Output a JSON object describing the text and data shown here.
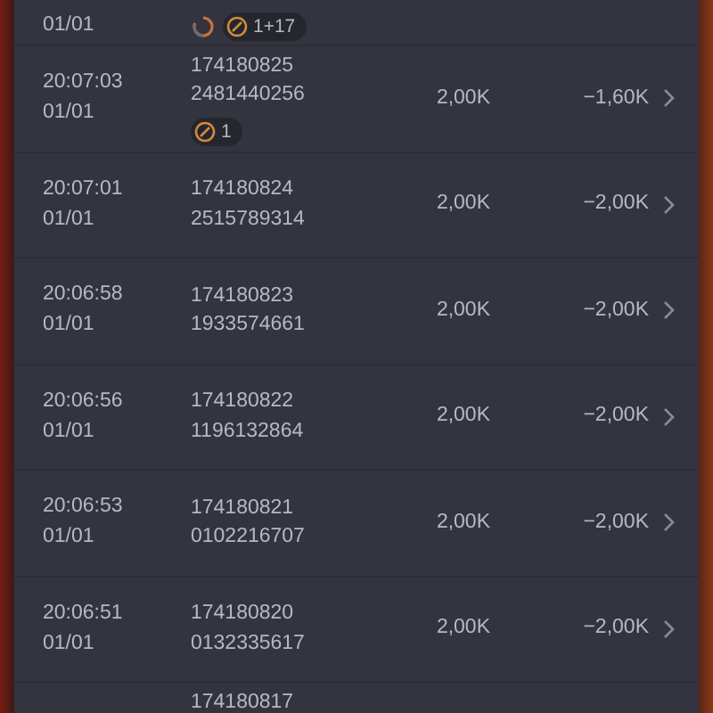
{
  "rows": [
    {
      "kind": "topcut",
      "date": "01/01",
      "badges": [
        {
          "kind": "refresh"
        },
        {
          "kind": "count",
          "text": "1+17"
        }
      ]
    },
    {
      "kind": "full",
      "time": "20:07:03",
      "date": "01/01",
      "ids": [
        "174180825",
        "2481440256"
      ],
      "badges": [
        {
          "kind": "count",
          "text": "1"
        }
      ],
      "amount": "2,00K",
      "pnl": "−1,60K"
    },
    {
      "kind": "full",
      "time": "20:07:01",
      "date": "01/01",
      "ids": [
        "174180824",
        "2515789314"
      ],
      "amount": "2,00K",
      "pnl": "−2,00K"
    },
    {
      "kind": "full",
      "time": "20:06:58",
      "date": "01/01",
      "ids": [
        "174180823",
        "1933574661"
      ],
      "amount": "2,00K",
      "pnl": "−2,00K"
    },
    {
      "kind": "full",
      "time": "20:06:56",
      "date": "01/01",
      "ids": [
        "174180822",
        "1196132864"
      ],
      "amount": "2,00K",
      "pnl": "−2,00K"
    },
    {
      "kind": "full",
      "time": "20:06:53",
      "date": "01/01",
      "ids": [
        "174180821",
        "0102216707"
      ],
      "amount": "2,00K",
      "pnl": "−2,00K"
    },
    {
      "kind": "full",
      "time": "20:06:51",
      "date": "01/01",
      "ids": [
        "174180820",
        "0132335617"
      ],
      "amount": "2,00K",
      "pnl": "−2,00K"
    },
    {
      "kind": "bottomcut",
      "ids": [
        "174180817"
      ]
    }
  ]
}
